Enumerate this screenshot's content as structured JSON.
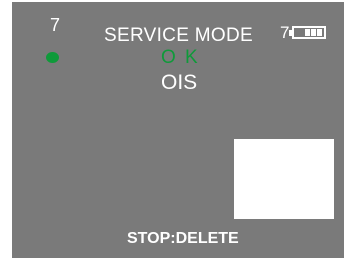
{
  "status": {
    "left_number": "7",
    "title": "SERVICE MODE",
    "right_number": "7",
    "battery_icon": "battery-icon",
    "indicator_color": "#0f9a3a"
  },
  "result": {
    "status_text": "O K",
    "test_name": "OIS"
  },
  "footer": {
    "hint": "STOP:DELETE"
  }
}
